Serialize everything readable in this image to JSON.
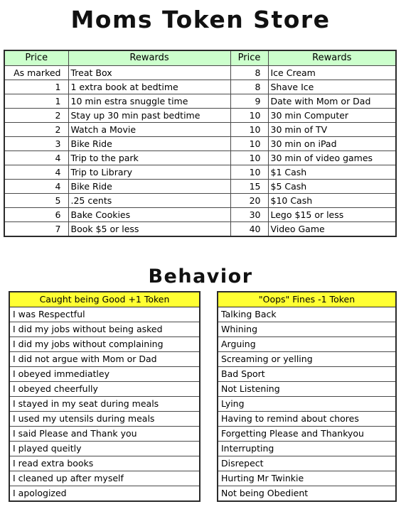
{
  "store": {
    "title": "Moms Token Store",
    "headers": [
      "Price",
      "Rewards",
      "Price",
      "Rewards"
    ],
    "rows": [
      {
        "price_left": "As marked",
        "reward_left": "Treat Box",
        "price_right": "8",
        "reward_right": "Ice Cream"
      },
      {
        "price_left": "1",
        "reward_left": "1 extra book at bedtime",
        "price_right": "8",
        "reward_right": "Shave Ice"
      },
      {
        "price_left": "1",
        "reward_left": "10 min estra snuggle time",
        "price_right": "9",
        "reward_right": "Date with Mom or Dad"
      },
      {
        "price_left": "2",
        "reward_left": "Stay up 30 min past bedtime",
        "price_right": "10",
        "reward_right": "30 min Computer"
      },
      {
        "price_left": "2",
        "reward_left": "Watch a Movie",
        "price_right": "10",
        "reward_right": "30 min of TV"
      },
      {
        "price_left": "3",
        "reward_left": "Bike Ride",
        "price_right": "10",
        "reward_right": "30 min on iPad"
      },
      {
        "price_left": "4",
        "reward_left": "Trip to the park",
        "price_right": "10",
        "reward_right": "30 min of video games"
      },
      {
        "price_left": "4",
        "reward_left": "Trip to Library",
        "price_right": "10",
        "reward_right": "$1 Cash"
      },
      {
        "price_left": "4",
        "reward_left": "Bike Ride",
        "price_right": "15",
        "reward_right": "$5 Cash"
      },
      {
        "price_left": "5",
        "reward_left": ".25 cents",
        "price_right": "20",
        "reward_right": "$10 Cash"
      },
      {
        "price_left": "6",
        "reward_left": "Bake Cookies",
        "price_right": "30",
        "reward_right": "Lego $15 or less"
      },
      {
        "price_left": "7",
        "reward_left": "Book $5 or less",
        "price_right": "40",
        "reward_right": "Video Game"
      }
    ]
  },
  "behavior": {
    "title": "Behavior",
    "good": {
      "header": "Caught being Good +1 Token",
      "items": [
        "I was Respectful",
        "I did my jobs without being asked",
        "I did my jobs without complaining",
        "I did not argue with Mom or Dad",
        "I obeyed immediatley",
        "I obeyed cheerfully",
        "I stayed in my seat during meals",
        "I used my utensils during meals",
        "I said Please and Thank you",
        "I played queitly",
        "I read extra books",
        "I cleaned up after myself",
        "I apologized"
      ]
    },
    "oops": {
      "header": "\"Oops\" Fines -1 Token",
      "items": [
        "Talking Back",
        "Whining",
        "Arguing",
        "Screaming or yelling",
        "Bad Sport",
        "Not Listening",
        "Lying",
        "Having to remind about chores",
        "Forgetting Please and Thankyou",
        "Interrupting",
        "Disrepect",
        "Hurting Mr Twinkie",
        "Not being Obedient"
      ]
    }
  },
  "colors": {
    "store_header_bg": "#ccffcc",
    "behavior_header_bg": "#ffff33",
    "border": "#2b2b2b",
    "text": "#000000"
  }
}
